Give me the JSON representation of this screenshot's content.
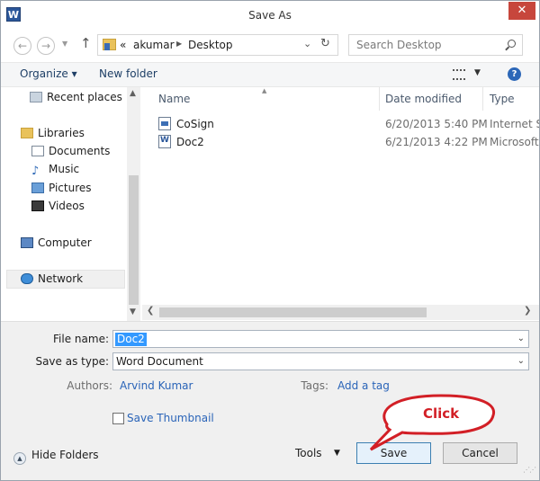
{
  "window": {
    "title": "Save As",
    "app_icon": "W",
    "close_label": "✕"
  },
  "navigation": {
    "back_icon": "←",
    "forward_icon": "→",
    "history_icon": "▼",
    "up_icon": "↑",
    "path_prefix": "«",
    "path": [
      "akumar",
      "Desktop"
    ],
    "dropdown_icon": "⌄",
    "refresh_icon": "↻",
    "search_placeholder": "Search Desktop"
  },
  "toolbar": {
    "organize_label": "Organize ▾",
    "new_folder_label": "New folder",
    "view_dropdown": "▼",
    "help_icon": "?"
  },
  "sidebar": {
    "items": [
      {
        "label": "Recent places",
        "icon": "recent-places-icon"
      },
      {
        "label": "Libraries",
        "icon": "libraries-icon"
      },
      {
        "label": "Documents",
        "icon": "documents-icon"
      },
      {
        "label": "Music",
        "icon": "music-icon"
      },
      {
        "label": "Pictures",
        "icon": "pictures-icon"
      },
      {
        "label": "Videos",
        "icon": "videos-icon"
      },
      {
        "label": "Computer",
        "icon": "computer-icon"
      },
      {
        "label": "Network",
        "icon": "network-icon"
      }
    ],
    "selected": "Network"
  },
  "file_list": {
    "columns": [
      "Name",
      "Date modified",
      "Type"
    ],
    "sort_indicator": "▲",
    "rows": [
      {
        "name": "CoSign",
        "date": "6/20/2013 5:40 PM",
        "type": "Internet S"
      },
      {
        "name": "Doc2",
        "date": "6/21/2013 4:22 PM",
        "type": "Microsoft"
      }
    ]
  },
  "scroll": {
    "up": "▲",
    "down": "▼",
    "left": "❮",
    "right": "❯"
  },
  "form": {
    "file_name_label": "File name:",
    "file_name_value": "Doc2",
    "save_type_label": "Save as type:",
    "save_type_value": "Word Document",
    "field_dropdown": "⌄",
    "authors_label": "Authors:",
    "authors_value": "Arvind Kumar",
    "tags_label": "Tags:",
    "tags_value": "Add a tag",
    "thumbnail_label": "Save Thumbnail"
  },
  "footer": {
    "hide_folders_label": "Hide Folders",
    "hide_folders_icon": "▲",
    "tools_label": "Tools",
    "tools_drop": "▼",
    "save_label": "Save",
    "cancel_label": "Cancel",
    "grip": "⋰⋰"
  },
  "annotation": {
    "text": "Click",
    "color": "#d21f26"
  }
}
